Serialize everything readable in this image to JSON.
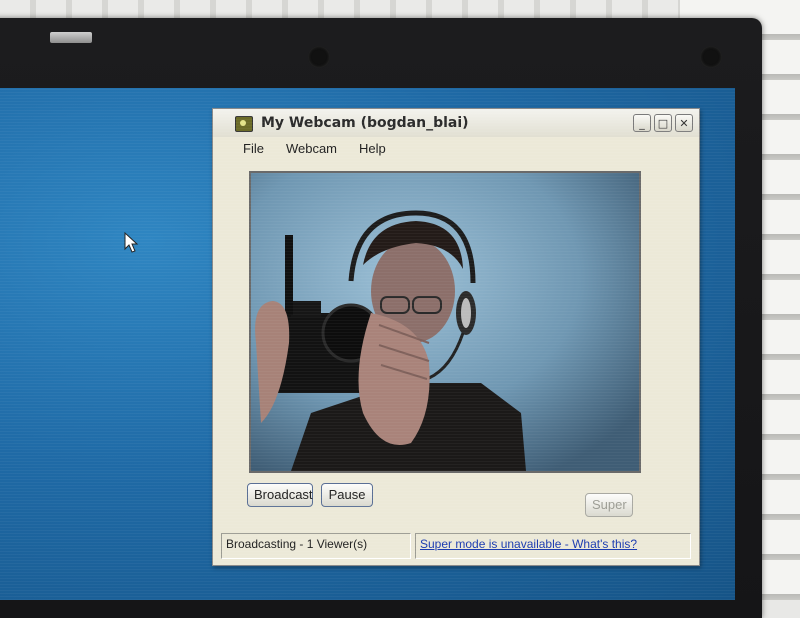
{
  "window": {
    "title": "My Webcam (bogdan_blai)",
    "controls": {
      "minimize": "_",
      "maximize": "□",
      "close": "✕"
    }
  },
  "menubar": [
    "File",
    "Webcam",
    "Help"
  ],
  "buttons": {
    "broadcast_label": "Broadcast",
    "pause_label": "Pause",
    "super_label": "Super"
  },
  "status": {
    "left": "Broadcasting - 1 Viewer(s)",
    "link": "Super mode is unavailable - What's this?"
  },
  "colors": {
    "desktop": "#1f6aa6",
    "window_bg": "#ece9d8",
    "link": "#1c3cb0"
  },
  "icons": [
    "webcam-app-icon",
    "minimize-icon",
    "maximize-icon",
    "close-icon",
    "mouse-cursor-icon"
  ]
}
